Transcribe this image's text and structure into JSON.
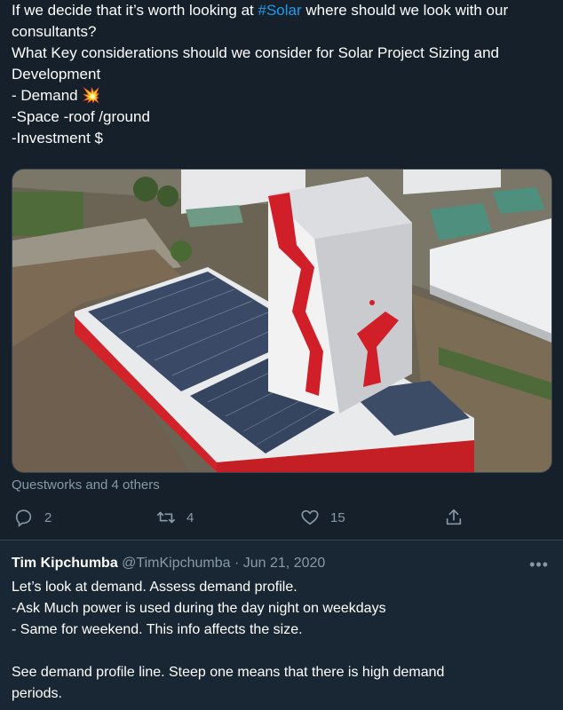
{
  "tweet": {
    "lines": [
      {
        "pre": "If we decide that it’s worth looking at ",
        "tag": "#Solar",
        "post": " where should we look with our"
      },
      {
        "pre": "consultants?",
        "tag": "",
        "post": ""
      },
      {
        "pre": "What Key considerations should we consider  for Solar Project Sizing and",
        "tag": "",
        "post": ""
      },
      {
        "pre": "Development",
        "tag": "",
        "post": ""
      },
      {
        "pre": "- Demand 💥",
        "tag": "",
        "post": ""
      },
      {
        "pre": "-Space -roof /ground",
        "tag": "",
        "post": ""
      },
      {
        "pre": "-Investment $",
        "tag": "",
        "post": ""
      }
    ],
    "likers_text": "Questworks and 4 others",
    "media_icon": "solar-rooftop-building-photo"
  },
  "actions": {
    "reply_count": "2",
    "retweet_count": "4",
    "like_count": "15",
    "icons": [
      "reply-icon",
      "retweet-icon",
      "like-icon",
      "share-icon"
    ]
  },
  "reply": {
    "name": "Tim Kipchumba",
    "handle": "@TimKipchumba",
    "separator": "·",
    "date": "Jun 21, 2020",
    "more": "•••",
    "lines": [
      "Let’s look at demand. Assess demand profile.",
      "-Ask Much power is used during the day night on weekdays",
      "- Same for weekend. This info affects the size.",
      "",
      "See demand profile line. Steep one means that there is high demand",
      "periods."
    ]
  },
  "colors": {
    "background": "#15202b",
    "reply_background": "#192734",
    "accent": "#1d9bf0",
    "muted": "#8899a6",
    "border": "#38444d"
  }
}
